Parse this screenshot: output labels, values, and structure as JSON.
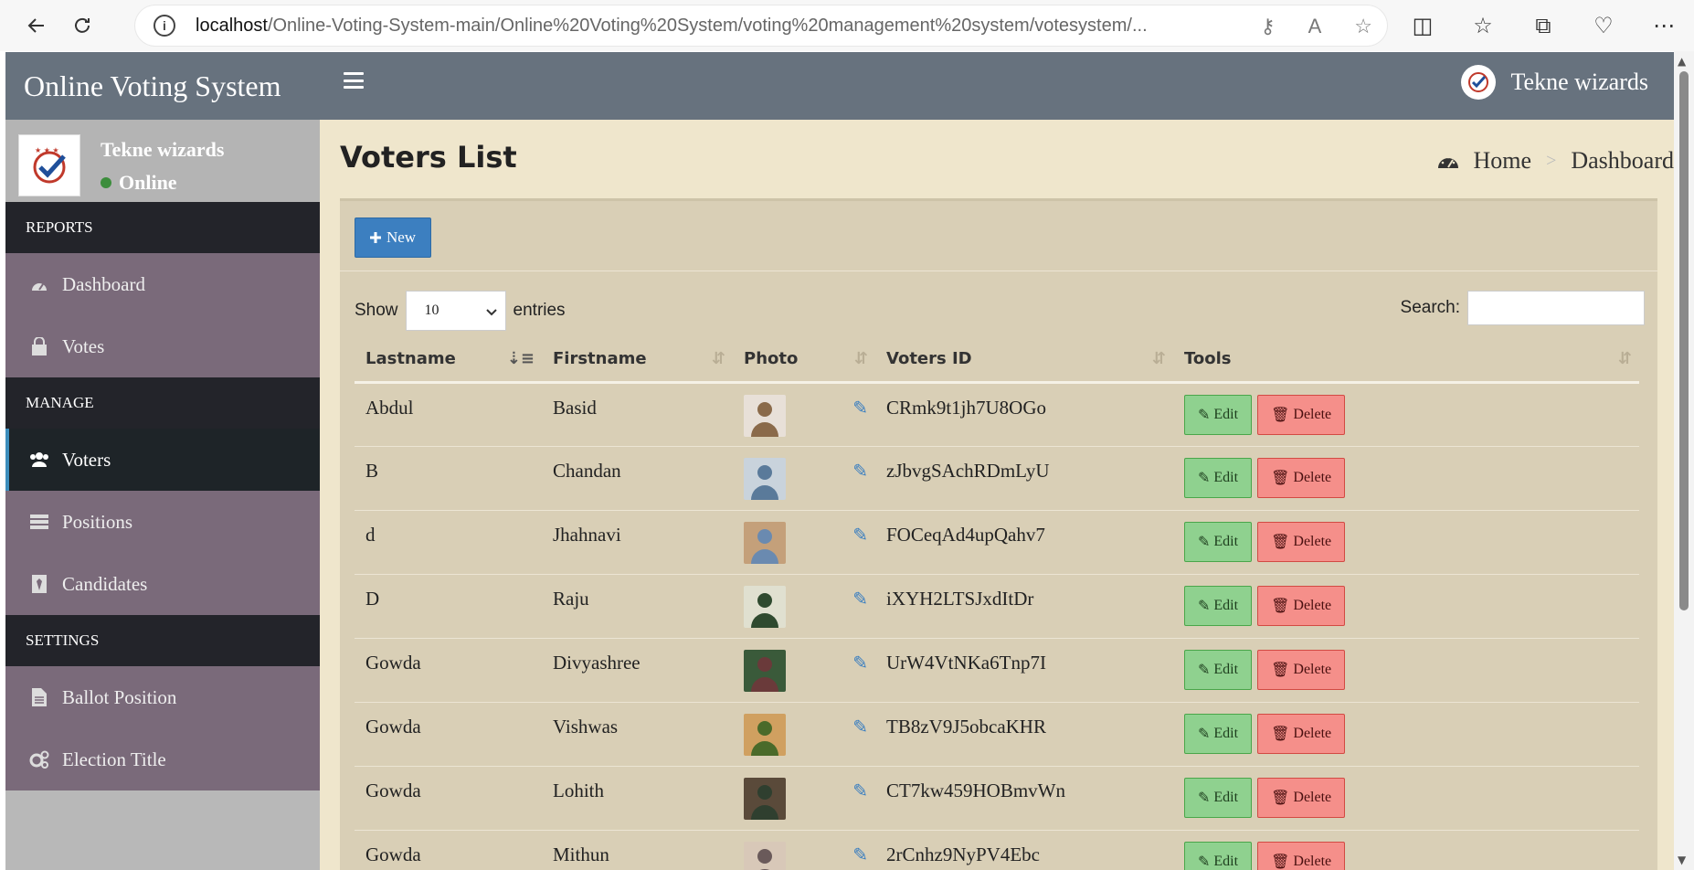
{
  "browser": {
    "url_host": "localhost",
    "url_path": "/Online-Voting-System-main/Online%20Voting%20System/voting%20management%20system/votesystem/..."
  },
  "app": {
    "logo_text": "Online Voting System",
    "user_name": "Tekne wizards"
  },
  "sidebar": {
    "user_name": "Tekne wizards",
    "status": "Online",
    "sections": [
      {
        "header": "REPORTS",
        "items": [
          {
            "label": "Dashboard",
            "icon": "dashboard-icon"
          },
          {
            "label": "Votes",
            "icon": "lock-icon"
          }
        ]
      },
      {
        "header": "MANAGE",
        "items": [
          {
            "label": "Voters",
            "icon": "users-icon",
            "active": true
          },
          {
            "label": "Positions",
            "icon": "tasks-icon"
          },
          {
            "label": "Candidates",
            "icon": "tie-icon"
          }
        ]
      },
      {
        "header": "SETTINGS",
        "items": [
          {
            "label": "Ballot Position",
            "icon": "file-icon"
          },
          {
            "label": "Election Title",
            "icon": "cogs-icon"
          }
        ]
      }
    ]
  },
  "content": {
    "title": "Voters List",
    "breadcrumb": {
      "home": "Home",
      "current": "Dashboard"
    },
    "new_label": "New",
    "show_label": "Show",
    "entries_value": "10",
    "entries_label": "entries",
    "search_label": "Search:",
    "search_value": ""
  },
  "table": {
    "headers": [
      "Lastname",
      "Firstname",
      "Photo",
      "Voters ID",
      "Tools"
    ],
    "edit_label": "Edit",
    "delete_label": "Delete",
    "rows": [
      {
        "lastname": "Abdul",
        "firstname": "Basid",
        "voters_id": "CRmk9t1jh7U8OGo"
      },
      {
        "lastname": "B",
        "firstname": "Chandan",
        "voters_id": "zJbvgSAchRDmLyU"
      },
      {
        "lastname": "d",
        "firstname": "Jhahnavi",
        "voters_id": "FOCeqAd4upQahv7"
      },
      {
        "lastname": "D",
        "firstname": "Raju",
        "voters_id": "iXYH2LTSJxdItDr"
      },
      {
        "lastname": "Gowda",
        "firstname": "Divyashree",
        "voters_id": "UrW4VtNKa6Tnp7I"
      },
      {
        "lastname": "Gowda",
        "firstname": "Vishwas",
        "voters_id": "TB8zV9J5obcaKHR"
      },
      {
        "lastname": "Gowda",
        "firstname": "Lohith",
        "voters_id": "CT7kw459HOBmvWn"
      },
      {
        "lastname": "Gowda",
        "firstname": "Mithun",
        "voters_id": "2rCnhz9NyPV4Ebc"
      }
    ]
  },
  "colors": {
    "header_bg": "#67727e",
    "content_bg": "#efe6cc",
    "box_bg": "#d9cfb6",
    "primary": "#3c7fc0",
    "success": "#8fd18f",
    "danger": "#f58f8a"
  }
}
